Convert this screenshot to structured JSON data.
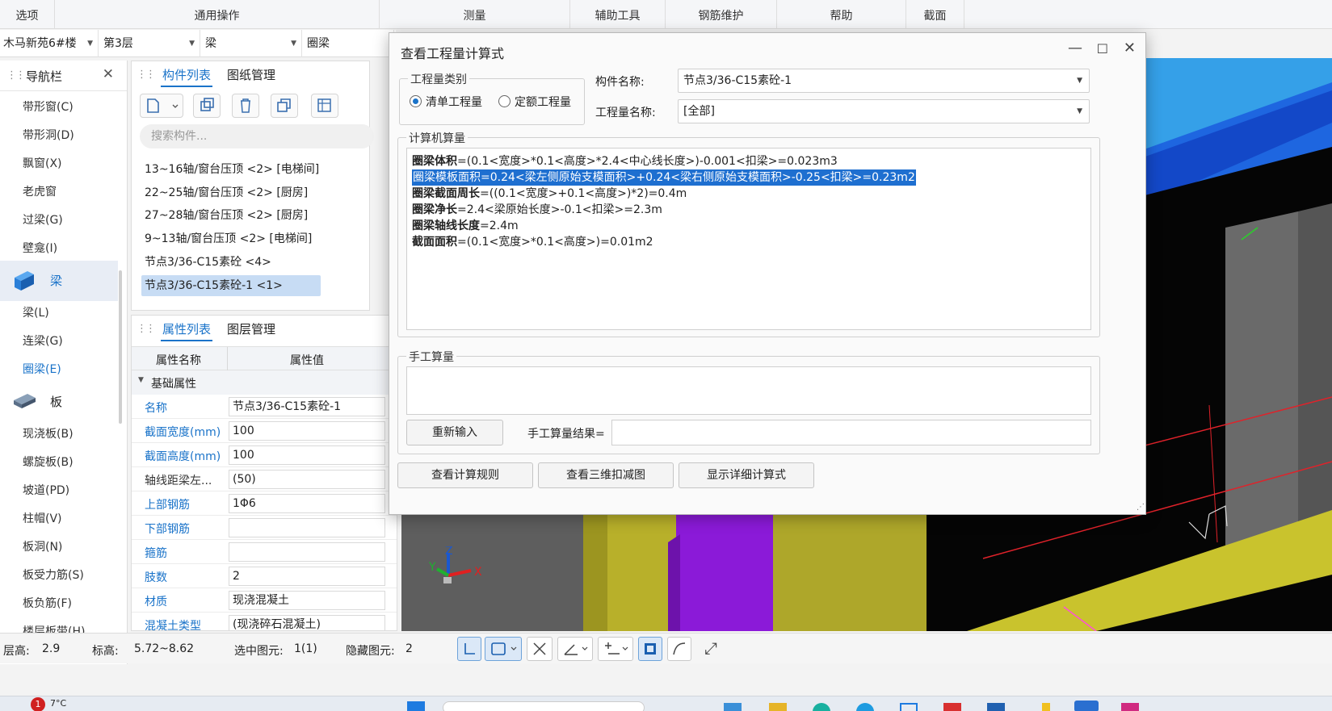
{
  "ribbon": {
    "tabs": [
      "选项",
      "通用操作",
      "测量",
      "辅助工具",
      "钢筋维护",
      "帮助",
      "截面"
    ]
  },
  "selectors": {
    "project": "木马新苑6#楼",
    "floor": "第3层",
    "category": "梁",
    "type": "圈梁"
  },
  "nav": {
    "title": "导航栏",
    "items_top": [
      "带形窗(C)",
      "带形洞(D)",
      "飘窗(X)",
      "老虎窗",
      "过梁(G)",
      "壁龛(I)"
    ],
    "group_beam": "梁",
    "items_beam": [
      "梁(L)",
      "连梁(G)",
      "圈梁(E)"
    ],
    "group_slab": "板",
    "items_slab": [
      "现浇板(B)",
      "螺旋板(B)",
      "坡道(PD)",
      "柱帽(V)",
      "板洞(N)",
      "板受力筋(S)",
      "板负筋(F)",
      "楼层板带(H)"
    ]
  },
  "components": {
    "tab_list": "构件列表",
    "tab_drawings": "图纸管理",
    "search_placeholder": "搜索构件...",
    "items": [
      "13~16轴/窗台压顶 <2> [电梯间]",
      "22~25轴/窗台压顶 <2> [厨房]",
      "27~28轴/窗台压顶 <2> [厨房]",
      "9~13轴/窗台压顶 <2> [电梯间]",
      "节点3/36-C15素砼 <4>",
      "节点3/36-C15素砼-1 <1>"
    ]
  },
  "properties": {
    "tab_list": "属性列表",
    "tab_layers": "图层管理",
    "col_name": "属性名称",
    "col_value": "属性值",
    "group_basic": "基础属性",
    "rows": [
      {
        "name": "名称",
        "value": "节点3/36-C15素砼-1"
      },
      {
        "name": "截面宽度(mm)",
        "value": "100"
      },
      {
        "name": "截面高度(mm)",
        "value": "100"
      },
      {
        "name": "轴线距梁左...",
        "value": "(50)"
      },
      {
        "name": "上部钢筋",
        "value": "1Φ6"
      },
      {
        "name": "下部钢筋",
        "value": ""
      },
      {
        "name": "箍筋",
        "value": ""
      },
      {
        "name": "肢数",
        "value": "2"
      },
      {
        "name": "材质",
        "value": "现浇混凝土"
      },
      {
        "name": "混凝土类型",
        "value": "(现浇碎石混凝土)"
      }
    ]
  },
  "dialog": {
    "title": "查看工程量计算式",
    "qty_type_label": "工程量类别",
    "radio_list": "清单工程量",
    "radio_quota": "定额工程量",
    "component_name_label": "构件名称:",
    "component_name_value": "节点3/36-C15素砼-1",
    "qty_name_label": "工程量名称:",
    "qty_name_value": "[全部]",
    "computer_section": "计算机算量",
    "formulas": [
      {
        "name": "圈梁体积",
        "expr": "=(0.1<宽度>*0.1<高度>*2.4<中心线长度>)-0.001<扣梁>=0.023m3"
      },
      {
        "name": "圈梁模板面积",
        "expr": "=0.24<梁左侧原始支模面积>+0.24<梁右侧原始支模面积>-0.25<扣梁>=0.23m2"
      },
      {
        "name": "圈梁截面周长",
        "expr": "=((0.1<宽度>+0.1<高度>)*2)=0.4m"
      },
      {
        "name": "圈梁净长",
        "expr": "=2.4<梁原始长度>-0.1<扣梁>=2.3m"
      },
      {
        "name": "圈梁轴线长度",
        "expr": "=2.4m"
      },
      {
        "name": "截面面积",
        "expr": "=(0.1<宽度>*0.1<高度>)=0.01m2"
      }
    ],
    "manual_section": "手工算量",
    "reinput_button": "重新输入",
    "manual_result_label": "手工算量结果=",
    "manual_result_value": "",
    "btn_rules": "查看计算规则",
    "btn_3d": "查看三维扣减图",
    "btn_detail": "显示详细计算式"
  },
  "status": {
    "floor_height_label": "层高:",
    "floor_height_value": "2.9",
    "elevation_label": "标高:",
    "elevation_value": "5.72~8.62",
    "selected_label": "选中图元:",
    "selected_value": "1(1)",
    "hidden_label": "隐藏图元:",
    "hidden_value": "2"
  },
  "taskbar": {
    "badge": "1",
    "temperature": "7°C"
  },
  "colors": {
    "accent": "#1a73c9",
    "highlight": "#1e6fd0",
    "beam_purple": "#8b1ad8",
    "beam_olive": "#b8b02a",
    "slab_blue": "#1e66e0"
  }
}
